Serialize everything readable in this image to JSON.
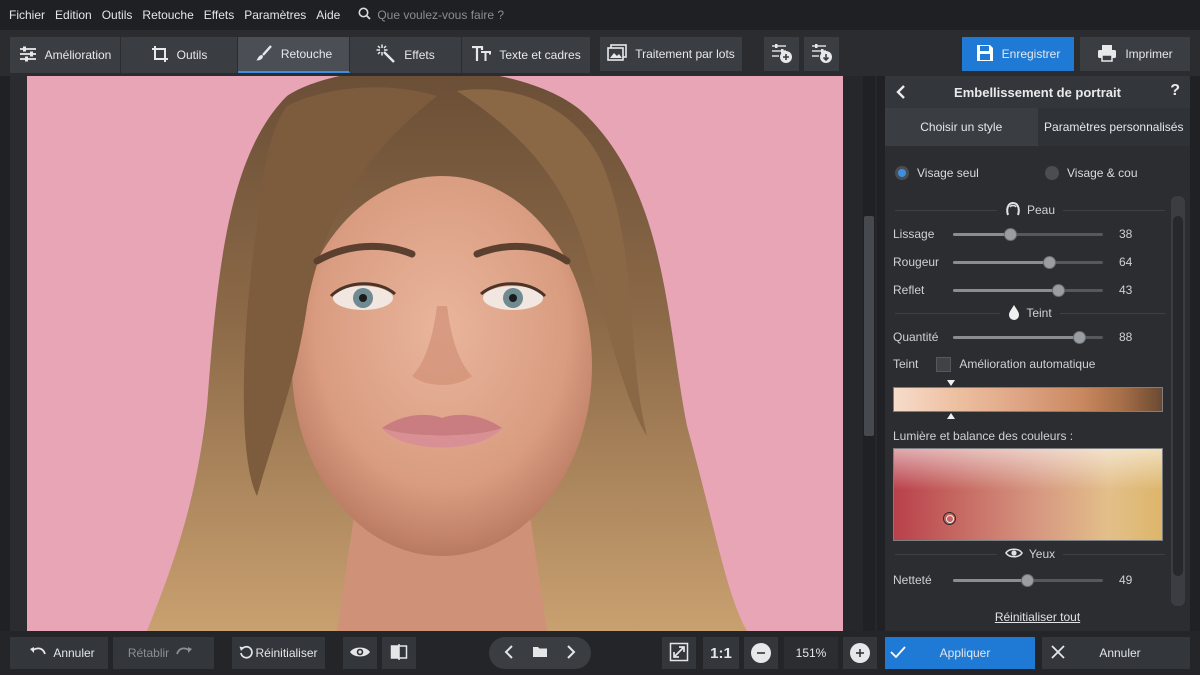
{
  "menu": {
    "items": [
      "Fichier",
      "Edition",
      "Outils",
      "Retouche",
      "Effets",
      "Paramètres",
      "Aide"
    ],
    "search_placeholder": "Que voulez-vous faire ?"
  },
  "toolbar": {
    "tabs": [
      "Amélioration",
      "Outils",
      "Retouche",
      "Effets",
      "Texte et cadres"
    ],
    "active_tab": "Retouche",
    "batch_label": "Traitement par lots",
    "save_label": "Enregistrer",
    "print_label": "Imprimer"
  },
  "panel": {
    "title": "Embellissement de portrait",
    "help": "?",
    "subtabs": [
      "Choisir un style",
      "Paramètres personnalisés"
    ],
    "active_subtab": "Paramètres personnalisés",
    "radio_options": [
      "Visage seul",
      "Visage & cou"
    ],
    "radio_selected": "Visage seul",
    "sections": {
      "skin": "Peau",
      "tint": "Teint",
      "eyes": "Yeux"
    },
    "sliders": [
      {
        "label": "Lissage",
        "value": 38
      },
      {
        "label": "Rougeur",
        "value": 64
      },
      {
        "label": "Reflet",
        "value": 43
      },
      {
        "label": "Quantité",
        "value": 88
      },
      {
        "label": "Netteté",
        "value": 49
      }
    ],
    "tint_label": "Teint",
    "auto_label": "Amélioration automatique",
    "auto_checked": false,
    "color_balance_label": "Lumière et balance des couleurs :",
    "reset_all": "Réinitialiser tout"
  },
  "bottom": {
    "undo": "Annuler",
    "redo": "Rétablir",
    "reset": "Réinitialiser",
    "actual_size": "1:1",
    "zoom": "151%",
    "apply": "Appliquer",
    "cancel": "Annuler"
  },
  "colors": {
    "accent": "#1f7ad6",
    "background": "#e7a5b6"
  }
}
